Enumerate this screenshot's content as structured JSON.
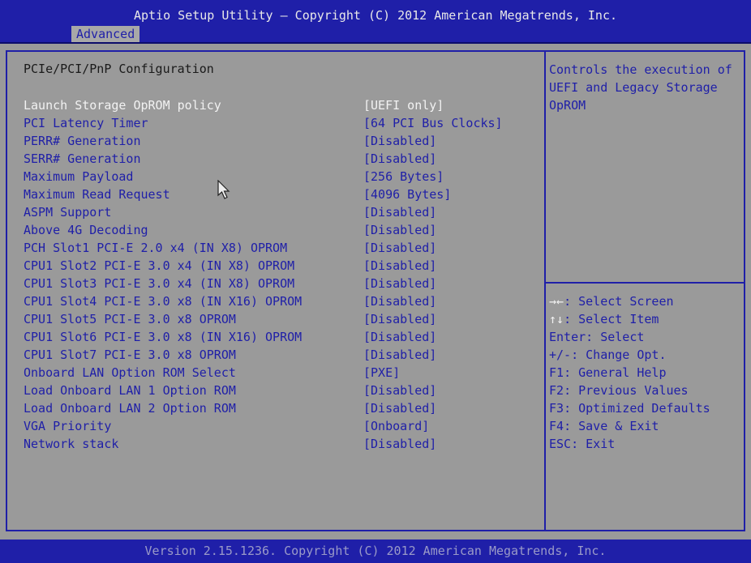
{
  "header": {
    "title": "Aptio Setup Utility – Copyright (C) 2012 American Megatrends, Inc.",
    "tabs": [
      {
        "label": "Advanced"
      }
    ]
  },
  "main": {
    "section_title": "PCIe/PCI/PnP Configuration",
    "settings": [
      {
        "label": "Launch Storage OpROM policy",
        "value": "[UEFI only]"
      },
      {
        "label": "PCI Latency Timer",
        "value": "[64 PCI Bus Clocks]"
      },
      {
        "label": "PERR# Generation",
        "value": "[Disabled]"
      },
      {
        "label": "SERR# Generation",
        "value": "[Disabled]"
      },
      {
        "label": "Maximum Payload",
        "value": "[256 Bytes]"
      },
      {
        "label": "Maximum Read Request",
        "value": "[4096 Bytes]"
      },
      {
        "label": "ASPM Support",
        "value": "[Disabled]"
      },
      {
        "label": "Above 4G Decoding",
        "value": "[Disabled]"
      },
      {
        "label": "PCH Slot1 PCI-E 2.0 x4 (IN X8) OPROM",
        "value": "[Disabled]"
      },
      {
        "label": "CPU1 Slot2 PCI-E 3.0 x4 (IN X8) OPROM",
        "value": "[Disabled]"
      },
      {
        "label": "CPU1 Slot3 PCI-E 3.0 x4 (IN X8) OPROM",
        "value": "[Disabled]"
      },
      {
        "label": "CPU1 Slot4 PCI-E 3.0 x8 (IN X16) OPROM",
        "value": "[Disabled]"
      },
      {
        "label": "CPU1 Slot5 PCI-E 3.0 x8 OPROM",
        "value": "[Disabled]"
      },
      {
        "label": "CPU1 Slot6 PCI-E 3.0 x8 (IN X16) OPROM",
        "value": "[Disabled]"
      },
      {
        "label": "CPU1 Slot7 PCI-E 3.0 x8 OPROM",
        "value": "[Disabled]"
      },
      {
        "label": "Onboard LAN Option ROM Select",
        "value": "[PXE]"
      },
      {
        "label": "Load Onboard LAN 1 Option ROM",
        "value": "[Disabled]"
      },
      {
        "label": "Load Onboard LAN 2 Option ROM",
        "value": "[Disabled]"
      },
      {
        "label": "VGA Priority",
        "value": "[Onboard]"
      },
      {
        "label": "Network stack",
        "value": "[Disabled]"
      }
    ]
  },
  "help": {
    "text": "Controls the execution of UEFI and Legacy Storage OpROM"
  },
  "keys": [
    {
      "key": "→←",
      "desc": ": Select Screen"
    },
    {
      "key": "↑↓",
      "desc": ": Select Item"
    },
    {
      "key": "Enter",
      "desc": ": Select"
    },
    {
      "key": "+/-",
      "desc": ": Change Opt."
    },
    {
      "key": "F1",
      "desc": ": General Help"
    },
    {
      "key": "F2",
      "desc": ": Previous Values"
    },
    {
      "key": "F3",
      "desc": ": Optimized Defaults"
    },
    {
      "key": "F4",
      "desc": ": Save & Exit"
    },
    {
      "key": "ESC",
      "desc": ": Exit"
    }
  ],
  "footer": {
    "text": "Version 2.15.1236. Copyright (C) 2012 American Megatrends, Inc."
  },
  "colors": {
    "bar_blue": "#1f1fa8",
    "background_gray": "#9a9a9a",
    "highlight_white": "#f2f2f2"
  }
}
